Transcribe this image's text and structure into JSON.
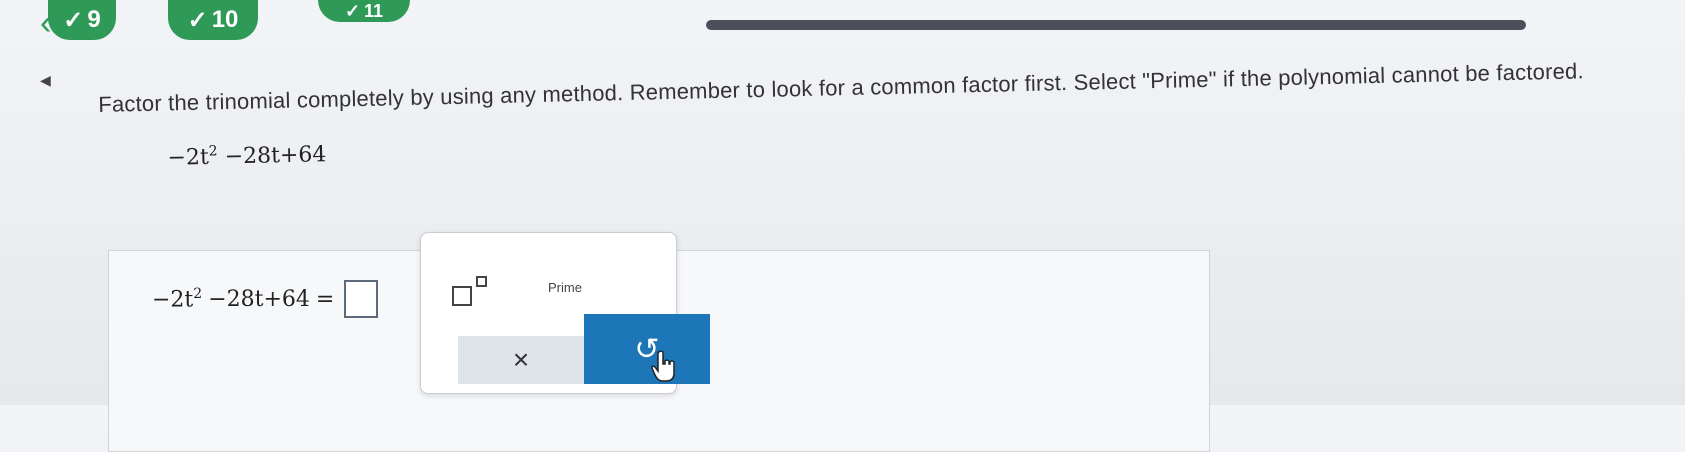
{
  "nav": {
    "back_icon": "chevron-left-icon",
    "questions": [
      {
        "label": "9",
        "status": "completed",
        "icon": "check-icon"
      },
      {
        "label": "10",
        "status": "completed",
        "icon": "check-icon"
      },
      {
        "label": "11",
        "status": "completed",
        "icon": "check-icon"
      }
    ],
    "accent_color": "#2f9a57"
  },
  "question": {
    "prompt": "Factor the trinomial completely by using any method. Remember to look for a common factor first. Select \"Prime\" if the polynomial cannot be factored.",
    "expression": {
      "coef": "−2t",
      "exp": "2",
      "rest": "−28t+64"
    }
  },
  "answer": {
    "lhs_coef": "−2t",
    "lhs_exp": "2",
    "lhs_rest": "−28t+64",
    "equals": "="
  },
  "toolbar": {
    "exponent_icon": "exponent-template-icon",
    "prime_label": "Prime",
    "clear_symbol": "×",
    "undo_symbol": "↺",
    "undo_color": "#1c76b8"
  }
}
